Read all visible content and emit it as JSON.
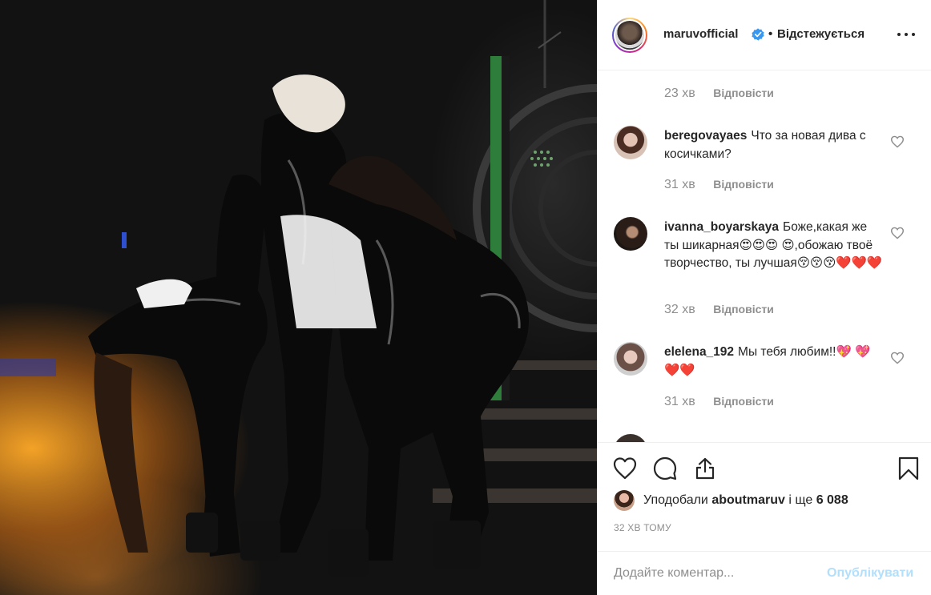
{
  "post": {
    "author": "maruvofficial",
    "separator": "•",
    "follow_state": "Відстежується",
    "reply_label": "Відповісти"
  },
  "comments": [
    {
      "time": "23 хв"
    },
    {
      "user": "beregovayaes",
      "text": "Что за новая дива с косичками?",
      "time": "31 хв"
    },
    {
      "user": "ivanna_boyarskaya",
      "text": "Боже,какая же ты шикарная😍😍😍 😍,обожаю твоё творчество, ты лучшая😚😚😚❤️❤️❤️",
      "time": "32 хв"
    },
    {
      "user": "elelena_192",
      "text": "Мы тебя любим!!💖 💖❤️❤️",
      "time": "31 хв"
    }
  ],
  "likes": {
    "prefix": "Уподобали",
    "user": "aboutmaruv",
    "connector": "і ще",
    "count": "6 088"
  },
  "timestamp": "32 ХВ ТОМУ",
  "add_comment": {
    "placeholder": "Додайте коментар...",
    "publish_label": "Опублікувати"
  },
  "icons": {
    "verified": "verified-badge-icon",
    "more": "more-options-icon",
    "like": "heart-icon",
    "comment": "comment-icon",
    "share": "share-icon",
    "save": "bookmark-icon"
  },
  "colors": {
    "verified_blue": "#3897f0",
    "publish_disabled": "#b2dffc",
    "secondary_text": "#8e8e8e"
  }
}
